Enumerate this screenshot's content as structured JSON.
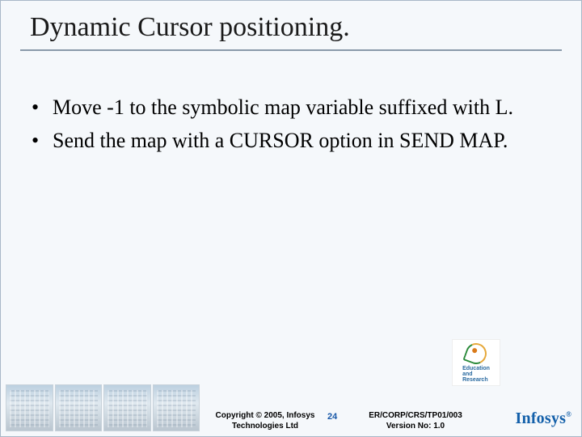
{
  "title": "Dynamic Cursor positioning.",
  "bullets": [
    "Move -1 to the symbolic map variable suffixed with L.",
    "Send the map with a CURSOR option in SEND MAP."
  ],
  "footer": {
    "copyright_line1": "Copyright © 2005, Infosys",
    "copyright_line2": "Technologies Ltd",
    "page_number": "24",
    "doc_ref": "ER/CORP/CRS/TP01/003",
    "version": "Version No: 1.0"
  },
  "logos": {
    "edu_line1": "Education",
    "edu_line2": "and",
    "edu_line3": "Research",
    "company": "Infosys",
    "reg": "®"
  }
}
